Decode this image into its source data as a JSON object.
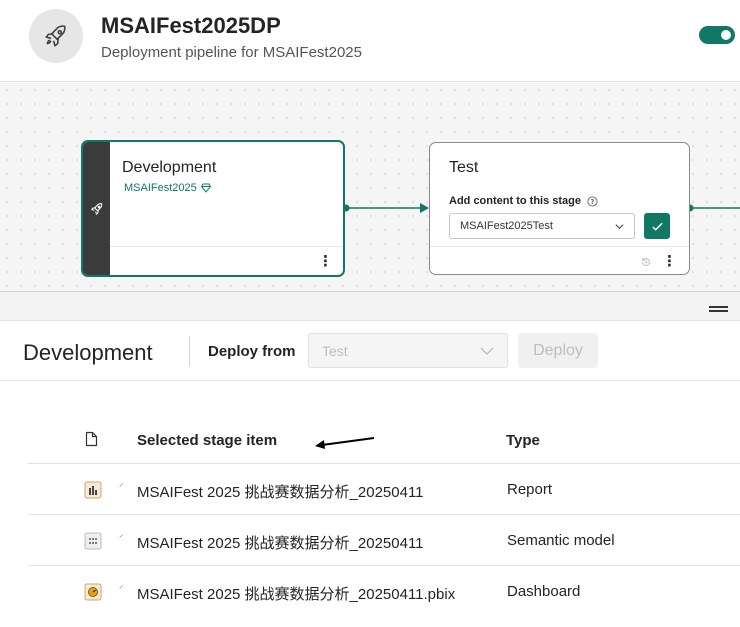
{
  "header": {
    "title": "MSAIFest2025DP",
    "subtitle": "Deployment pipeline for MSAIFest2025",
    "logo_icon": "rocket-icon",
    "toggle_on": true,
    "accent_color": "#117865"
  },
  "stages": {
    "development": {
      "name": "Development",
      "workspace": "MSAIFest2025",
      "workspace_icon": "diamond-icon"
    },
    "test": {
      "name": "Test",
      "add_content_label": "Add content to this stage",
      "workspace_select_value": "MSAIFest2025Test"
    }
  },
  "toolbar": {
    "stage_title": "Development",
    "deploy_from_label": "Deploy from",
    "deploy_from_value": "Test",
    "deploy_button": "Deploy"
  },
  "table": {
    "columns": {
      "item": "Selected stage item",
      "type": "Type"
    },
    "rows": [
      {
        "icon": "report-icon",
        "name": "MSAIFest 2025 挑战赛数据分析_20250411",
        "type": "Report"
      },
      {
        "icon": "semantic-model-icon",
        "name": "MSAIFest 2025 挑战赛数据分析_20250411",
        "type": "Semantic model"
      },
      {
        "icon": "dashboard-icon",
        "name": "MSAIFest 2025 挑战赛数据分析_20250411.pbix",
        "type": "Dashboard"
      }
    ]
  }
}
